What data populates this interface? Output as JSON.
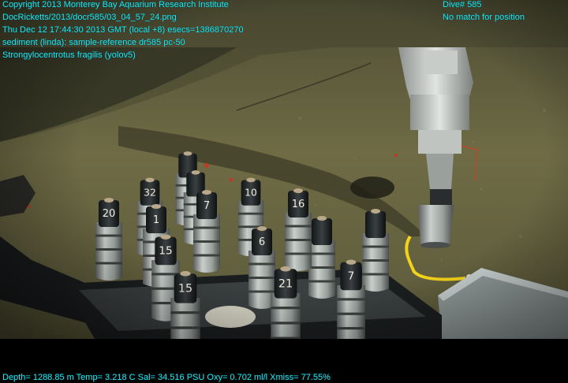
{
  "overlay_top_left": {
    "copyright": "Copyright 2013 Monterey Bay Aquarium Research Institute",
    "file_path": "DocRicketts/2013/docr585/03_04_57_24.png",
    "timestamp": "Thu Dec 12 17:44:30 2013 GMT (local +8)  esecs=1386870270",
    "sample_note": "sediment (linda): sample-reference dr585 pc-50",
    "species_detection": "Strongylocentrotus fragilis (yolov5)"
  },
  "overlay_top_right": {
    "dive": "Dive# 585",
    "position_status": "No match for position"
  },
  "overlay_bottom": {
    "telemetry": "Depth= 1288.85 m  Temp= 3.218 C  Sal= 34.516 PSU  Oxy= 0.702 ml/l  Xmiss= 77.55%"
  },
  "core_labels": [
    "20",
    "32",
    "1",
    "7",
    "10",
    "16",
    "6",
    "15",
    "15",
    "21",
    "7"
  ],
  "colors": {
    "overlay_text": "#1ee6f0",
    "seafloor": "#6e6a44",
    "marker_line": "#f2d21c"
  }
}
